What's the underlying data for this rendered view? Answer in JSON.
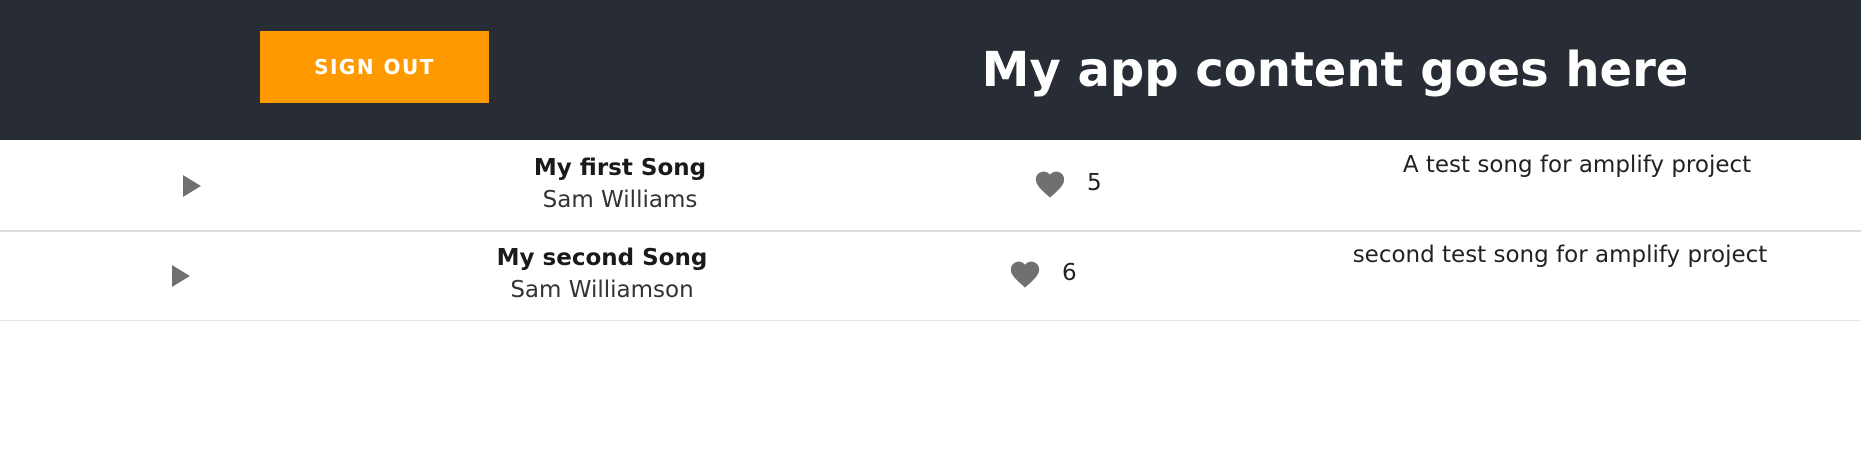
{
  "header": {
    "signout_label": "SIGN OUT",
    "title": "My app content goes here"
  },
  "colors": {
    "header_bg": "#282c34",
    "signout_bg": "#ff9900",
    "icon_gray": "#707070"
  },
  "songs": [
    {
      "title": "My first Song",
      "artist": "Sam Williams",
      "likes": "5",
      "description": "A test song for amplify project"
    },
    {
      "title": "My second Song",
      "artist": "Sam Williamson",
      "likes": "6",
      "description": "second test song for amplify project"
    }
  ]
}
